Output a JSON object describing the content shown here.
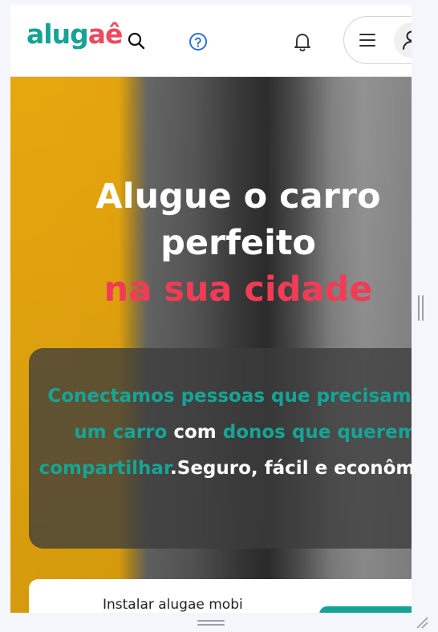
{
  "header": {
    "logo": {
      "text_main": "alug",
      "text_accent": "aê"
    },
    "icons": [
      "search-icon",
      "help-icon",
      "bell-icon",
      "menu-icon",
      "user-icon"
    ]
  },
  "hero": {
    "title_line1": "Alugue o carro",
    "title_line2": "perfeito",
    "title_accent": "na sua cidade",
    "info": {
      "part1": "Conectamos pessoas que precisam de um carro",
      "part2": " com ",
      "part3": "donos que querem compartilhar",
      "part4": ".Seguro, fácil e econômico."
    }
  },
  "install_banner": {
    "label": "Instalar alugae mobi"
  },
  "colors": {
    "brand_teal": "#16a394",
    "brand_red": "#ee4a5d",
    "accent_red": "#f23c55",
    "hero_yellow": "#f2b00f"
  }
}
